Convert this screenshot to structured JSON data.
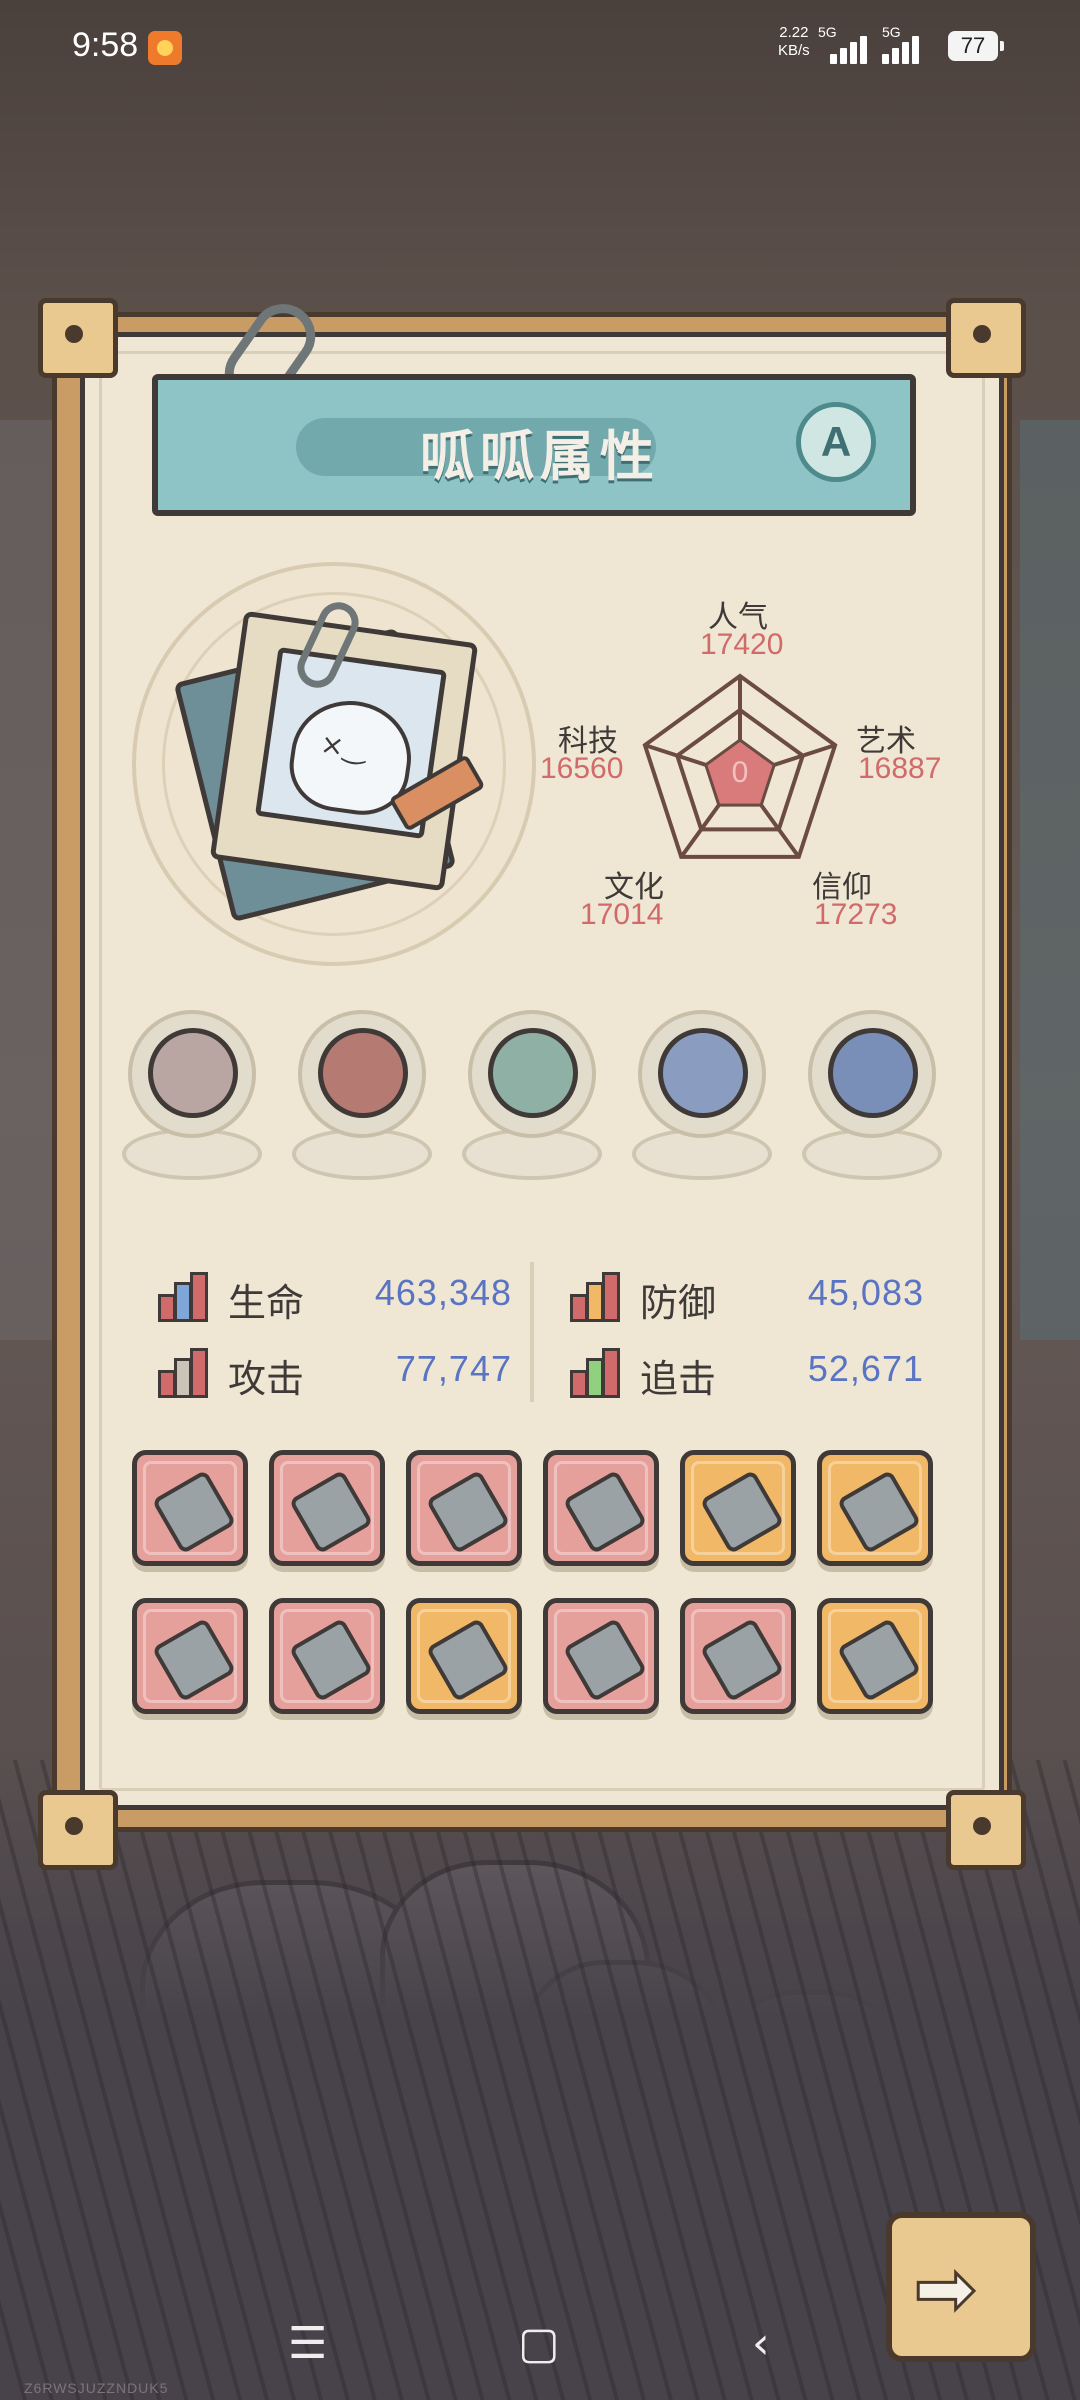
{
  "status_bar": {
    "time": "9:58",
    "net_speed": "2.22",
    "net_unit": "KB/s",
    "sim1": "5G",
    "sim2": "5G",
    "battery": "77"
  },
  "panel": {
    "title": "呱呱属性",
    "grade": "A"
  },
  "radar": {
    "center": "0",
    "stats": [
      {
        "label": "人气",
        "value": 17420
      },
      {
        "label": "艺术",
        "value": 16887
      },
      {
        "label": "信仰",
        "value": 17273
      },
      {
        "label": "文化",
        "value": 17014
      },
      {
        "label": "科技",
        "value": 16560
      }
    ]
  },
  "relics": [
    {
      "icon": "mechanical-claw-relic-icon"
    },
    {
      "icon": "monster-jaw-relic-icon"
    },
    {
      "icon": "armored-orb-relic-icon"
    },
    {
      "icon": "compass-relic-icon"
    },
    {
      "icon": "gem-cubes-relic-icon"
    }
  ],
  "combat_stats": [
    {
      "label": "生命",
      "value": "463,348",
      "icon": "health-bars-icon"
    },
    {
      "label": "防御",
      "value": "45,083",
      "icon": "defense-bars-icon"
    },
    {
      "label": "攻击",
      "value": "77,747",
      "icon": "attack-bars-icon"
    },
    {
      "label": "追击",
      "value": "52,671",
      "icon": "pursuit-bars-icon"
    }
  ],
  "equipment": [
    {
      "icon": "visor-icon",
      "rarity": "red"
    },
    {
      "icon": "winged-armor-icon",
      "rarity": "red"
    },
    {
      "icon": "sword-icon",
      "rarity": "red"
    },
    {
      "icon": "chest-plate-icon",
      "rarity": "red"
    },
    {
      "icon": "mummy-armor-icon",
      "rarity": "orange"
    },
    {
      "icon": "golem-armor-icon",
      "rarity": "orange"
    },
    {
      "icon": "scepter-icon",
      "rarity": "red"
    },
    {
      "icon": "spear-icon",
      "rarity": "red"
    },
    {
      "icon": "trident-icon",
      "rarity": "orange"
    },
    {
      "icon": "crossbow-icon",
      "rarity": "red"
    },
    {
      "icon": "winged-sandal-icon",
      "rarity": "red"
    },
    {
      "icon": "dagger-icon",
      "rarity": "orange"
    }
  ],
  "watermark": "Z6RWSJUZZNDUK5",
  "colors": {
    "panel_bg": "#efe7d4",
    "banner": "#8fc4c6",
    "stat_red": "#d16a6a",
    "stat_blue": "#5a74c4",
    "equip_red": "#e6a09b",
    "equip_orange": "#f1b868"
  }
}
